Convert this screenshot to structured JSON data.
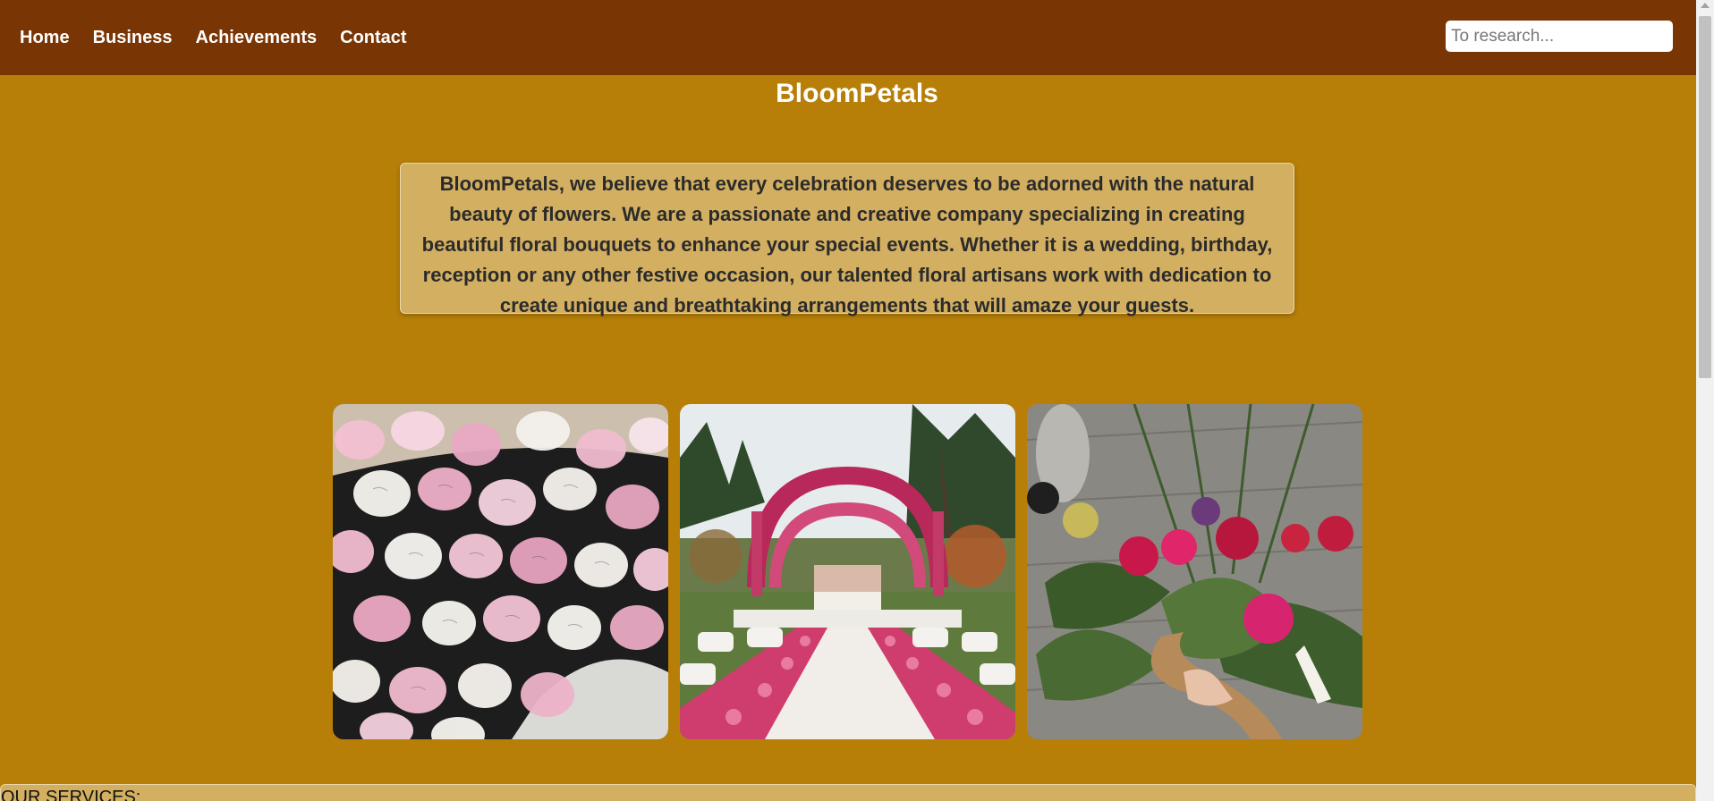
{
  "nav": {
    "items": [
      {
        "label": "Home"
      },
      {
        "label": "Business"
      },
      {
        "label": "Achievements"
      },
      {
        "label": "Contact"
      }
    ],
    "search_placeholder": "To research..."
  },
  "site_title": "BloomPetals",
  "intro_text": "BloomPetals, we believe that every celebration deserves to be adorned with the natural beauty of flowers. We are a passionate and creative company specializing in creating beautiful floral bouquets to enhance your special events. Whether it is a wedding, birthday, reception or any other festive occasion, our talented floral artisans work with dedication to create unique and breathtaking arrangements that will amaze your guests.",
  "services": {
    "title": "OUR SERVICES:"
  },
  "colors": {
    "navbar": "#7a3505",
    "background": "#b77f08",
    "panel": "#d3af61"
  }
}
